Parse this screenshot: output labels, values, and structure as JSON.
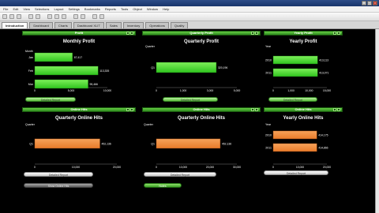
{
  "window": {
    "min_glyph": "_",
    "max_glyph": "□",
    "close_glyph": "×"
  },
  "menu": [
    "File",
    "Edit",
    "View",
    "Selections",
    "Layout",
    "Settings",
    "Bookmarks",
    "Reports",
    "Tools",
    "Object",
    "Window",
    "Help"
  ],
  "tabs": [
    "Introduction",
    "Dashboard",
    "Charts",
    "Dashboard XLIT",
    "Sales",
    "Inventory",
    "Operations",
    "Quality"
  ],
  "active_tab_index": 0,
  "colors": {
    "accent_green": "#33bb22",
    "bar_green": "#2fc41e",
    "bar_orange": "#e87b2a",
    "panel_bg": "#000000"
  },
  "panels": [
    {
      "header": "Profit",
      "title": "Monthly Profit",
      "axis_caption": "Month",
      "bars": {
        "color": "green",
        "categories": [
          "Jan",
          "Feb",
          "Mar"
        ],
        "values": [
          67417,
          113335,
          95466
        ],
        "labels": [
          "67,417",
          "113,335",
          "95,466"
        ]
      },
      "ticks": [
        "0",
        "5,000",
        "10,000"
      ],
      "max": 130000,
      "button_label": "Detailed Report",
      "button_style": "green"
    },
    {
      "header": "Quarterly Profit",
      "title": "Quarterly Profit",
      "axis_caption": "Quarter",
      "bars": {
        "color": "green",
        "categories": [
          "Q1"
        ],
        "values": [
          320196
        ],
        "labels": [
          "320,196"
        ]
      },
      "ticks": [
        "0",
        "1,000",
        "3,000",
        "5,000"
      ],
      "max": 430000,
      "button_label": "Detailed Report",
      "button_style": "green"
    },
    {
      "header": "Yearly Profit",
      "title": "Yearly Profit",
      "axis_caption": "Year",
      "bars": {
        "color": "green",
        "categories": [
          "2010",
          "2011"
        ],
        "values": [
          413113,
          413071
        ],
        "labels": [
          "413,113",
          "413,071"
        ]
      },
      "ticks": [
        "0",
        "1,000",
        "10,000",
        "15,000"
      ],
      "max": 500000,
      "button_label": "Detailed Report",
      "button_style": "green"
    },
    {
      "header": "Online Hits",
      "title": "Quarterly Online Hits",
      "axis_caption": "Quarter",
      "bars": {
        "color": "orange",
        "categories": [
          "Q1"
        ],
        "values": [
          452136
        ],
        "labels": [
          "452,136"
        ]
      },
      "ticks": [
        "0",
        "10,000",
        "20,000"
      ],
      "max": 570000,
      "button_label": "Detailed Report",
      "button_style": "grey",
      "extra_button_label": "Show Online Hits",
      "extra_button_style": "dark"
    },
    {
      "header": "Online Hits",
      "title": "Quarterly Online Hits",
      "axis_caption": "Quarter",
      "bars": {
        "color": "orange",
        "categories": [
          "Q1"
        ],
        "values": [
          452136
        ],
        "labels": [
          "452,136"
        ]
      },
      "ticks": [
        "0",
        "10,000",
        "20,000",
        "30,000"
      ],
      "max": 570000,
      "button_label": "Detailed Report",
      "button_style": "grey",
      "extra_button_label": "Notes",
      "extra_button_style": "bright"
    },
    {
      "header": "Online Hits",
      "title": "Yearly Online Hits",
      "axis_caption": "Year",
      "bars": {
        "color": "orange",
        "categories": [
          "2010",
          "2011"
        ],
        "values": [
          414175,
          414866
        ],
        "labels": [
          "414,175",
          "414,866"
        ]
      },
      "ticks": [
        "0",
        "10,000",
        "20,000"
      ],
      "max": 510000,
      "button_label": "Detailed Report",
      "button_style": "grey"
    }
  ]
}
